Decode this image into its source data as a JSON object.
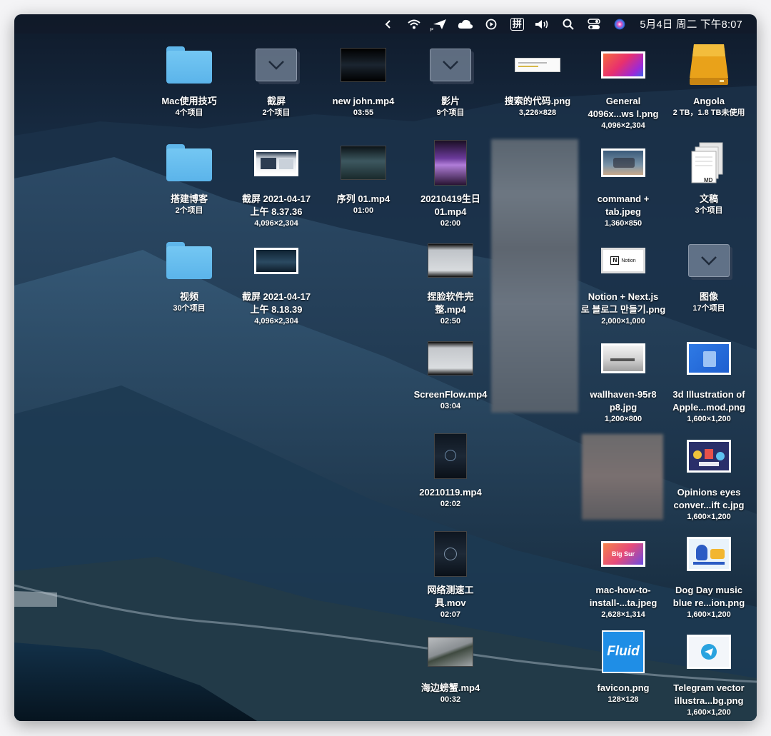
{
  "menubar": {
    "clock": "5月4日 周二 下午8:07",
    "icons": [
      "chevron-left-icon",
      "wifi-icon",
      "paper-plane-icon",
      "cloud-icon",
      "play-circle-icon",
      "input-method-icon",
      "volume-icon",
      "search-icon",
      "control-center-icon",
      "siri-icon"
    ],
    "input_method_glyph": "拼",
    "paper_plane_sub": "P"
  },
  "items": [
    {
      "name": "Mac使用技巧",
      "meta": "4个项目",
      "kind": "folder"
    },
    {
      "name": "截屏",
      "meta": "2个项目",
      "kind": "gray-folder"
    },
    {
      "name": "new john.mp4",
      "meta": "03:55",
      "kind": "video"
    },
    {
      "name": "影片",
      "meta": "9个项目",
      "kind": "gray-folder"
    },
    {
      "name": "搜索的代码.png",
      "meta": "3,226×828",
      "kind": "image"
    },
    {
      "name": "General\n4096x...ws l.png",
      "meta": "4,096×2,304",
      "kind": "image"
    },
    {
      "name": "Angola",
      "meta": "2 TB，1.8 TB未使用",
      "kind": "drive"
    },
    {
      "name": "搭建博客",
      "meta": "2个项目",
      "kind": "folder"
    },
    {
      "name": "截屏 2021-04-17\n上午 8.37.36",
      "meta": "4,096×2,304",
      "kind": "screenshot"
    },
    {
      "name": "序列 01.mp4",
      "meta": "01:00",
      "kind": "video"
    },
    {
      "name": "20210419生日\n01.mp4",
      "meta": "02:00",
      "kind": "video"
    },
    {
      "name": "command +\ntab.jpeg",
      "meta": "1,360×850",
      "kind": "image"
    },
    {
      "name": "文稿",
      "meta": "3个项目",
      "kind": "document"
    },
    {
      "name": "视频",
      "meta": "30个项目",
      "kind": "folder"
    },
    {
      "name": "截屏 2021-04-17\n上午 8.18.39",
      "meta": "4,096×2,304",
      "kind": "screenshot"
    },
    {
      "name": "捏脸软件完\n整.mp4",
      "meta": "02:50",
      "kind": "video"
    },
    {
      "name": "Notion + Next.js\n로 블로그 만들기.png",
      "meta": "2,000×1,000",
      "kind": "image"
    },
    {
      "name": "图像",
      "meta": "17个项目",
      "kind": "gray-folder"
    },
    {
      "name": "ScreenFlow.mp4",
      "meta": "03:04",
      "kind": "video"
    },
    {
      "name": "wallhaven-95r8\np8.jpg",
      "meta": "1,200×800",
      "kind": "image"
    },
    {
      "name": "3d Illustration of\nApple...mod.png",
      "meta": "1,600×1,200",
      "kind": "image"
    },
    {
      "name": "20210119.mp4",
      "meta": "02:02",
      "kind": "video"
    },
    {
      "name": "Opinions eyes\nconver...ift c.jpg",
      "meta": "1,600×1,200",
      "kind": "image"
    },
    {
      "name": "网络测速工\n具.mov",
      "meta": "02:07",
      "kind": "video"
    },
    {
      "name": "mac-how-to-\ninstall-...ta.jpeg",
      "meta": "2,628×1,314",
      "kind": "image"
    },
    {
      "name": "Dog Day music\nblue re...ion.png",
      "meta": "1,600×1,200",
      "kind": "image"
    },
    {
      "name": "海边螃蟹.mp4",
      "meta": "00:32",
      "kind": "video"
    },
    {
      "name": "favicon.png",
      "meta": "128×128",
      "kind": "image"
    },
    {
      "name": "Telegram vector\nillustra...bg.png",
      "meta": "1,600×1,200",
      "kind": "image"
    }
  ],
  "thumb_text": {
    "notion_label": "Notion",
    "big_sur_label": "Big Sur",
    "fluid_label": "Fluid",
    "md_label": "MD"
  },
  "colors": {
    "folder_blue": "#5bb4ea",
    "drive_orange": "#e9a21a"
  }
}
